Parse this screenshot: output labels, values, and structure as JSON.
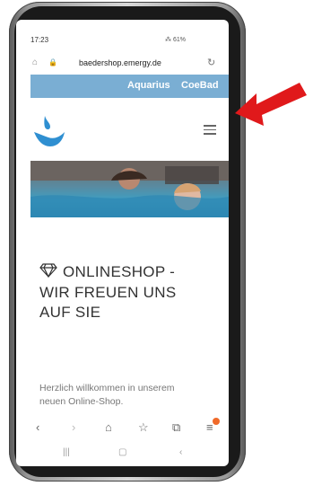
{
  "status": {
    "time": "17:23",
    "icons_text": "⁂ 61%"
  },
  "browser": {
    "url": "baedershop.emergy.de"
  },
  "topnav": {
    "items": [
      "Aquarius",
      "CoeBad"
    ]
  },
  "page": {
    "heading_lines": [
      "ONLINESHOP -",
      "WIR FREUEN UNS",
      "AUF SIE"
    ],
    "intro_lines": [
      "Herzlich willkommen in unserem",
      "neuen Online-Shop."
    ]
  },
  "icons": {
    "logo": "water-drop-logo",
    "menu": "hamburger-menu-icon",
    "gem": "diamond-icon",
    "annotation": "red-arrow-pointer"
  },
  "colors": {
    "nav_bar": "#7aaed3",
    "accent": "#e0191b",
    "logo_blue": "#2f8fd1"
  }
}
